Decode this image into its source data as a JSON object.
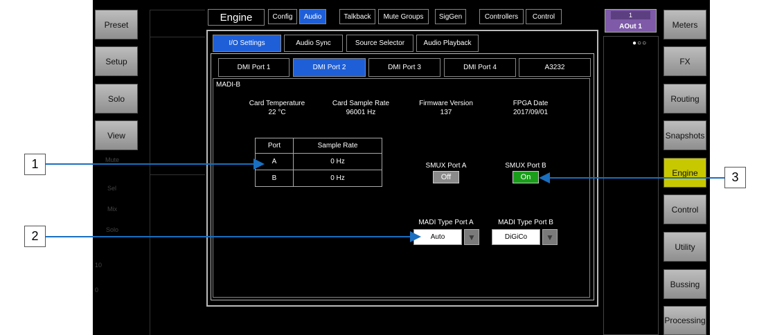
{
  "left_nav": [
    "Preset",
    "Setup",
    "Solo",
    "View"
  ],
  "right_nav": [
    "Meters",
    "FX",
    "Routing",
    "Snapshots",
    "Engine",
    "Control",
    "Utility",
    "Bussing",
    "Processing"
  ],
  "engine_tab": "Engine",
  "top_tabs": [
    "Config",
    "Audio",
    "Talkback",
    "Mute Groups",
    "SigGen",
    "Controllers",
    "Control"
  ],
  "output_badge": {
    "number": "1",
    "name": "AOut 1"
  },
  "sub_tabs": [
    "I/O Settings",
    "Audio Sync",
    "Source Selector",
    "Audio Playback"
  ],
  "port_tabs": [
    "DMI Port 1",
    "DMI Port 2",
    "DMI Port 3",
    "DMI Port 4",
    "A3232"
  ],
  "card_name": "MADI-B",
  "info": [
    {
      "label": "Card Temperature",
      "value": "22 °C"
    },
    {
      "label": "Card Sample Rate",
      "value": "96001 Hz"
    },
    {
      "label": "Firmware Version",
      "value": "137"
    },
    {
      "label": "FPGA Date",
      "value": "2017/09/01"
    }
  ],
  "port_table": {
    "headers": [
      "Port",
      "Sample Rate"
    ],
    "rows": [
      [
        "A",
        "0 Hz"
      ],
      [
        "B",
        "0 Hz"
      ]
    ]
  },
  "smux": [
    {
      "label": "SMUX Port A",
      "state": "Off"
    },
    {
      "label": "SMUX Port B",
      "state": "On"
    }
  ],
  "madi_type": [
    {
      "label": "MADI Type Port A",
      "value": "Auto"
    },
    {
      "label": "MADI Type Port B",
      "value": "DiGiCo"
    }
  ],
  "strip_faint": [
    "Mute",
    "Sel",
    "Mix",
    "Solo",
    "10",
    "0"
  ],
  "callouts": [
    "1",
    "2",
    "3"
  ],
  "colors": {
    "accent_blue": "#1e5fd8",
    "active_yellow": "#c8c800",
    "on_green": "#1a9e1a",
    "callout_line": "#1a6fc0"
  }
}
